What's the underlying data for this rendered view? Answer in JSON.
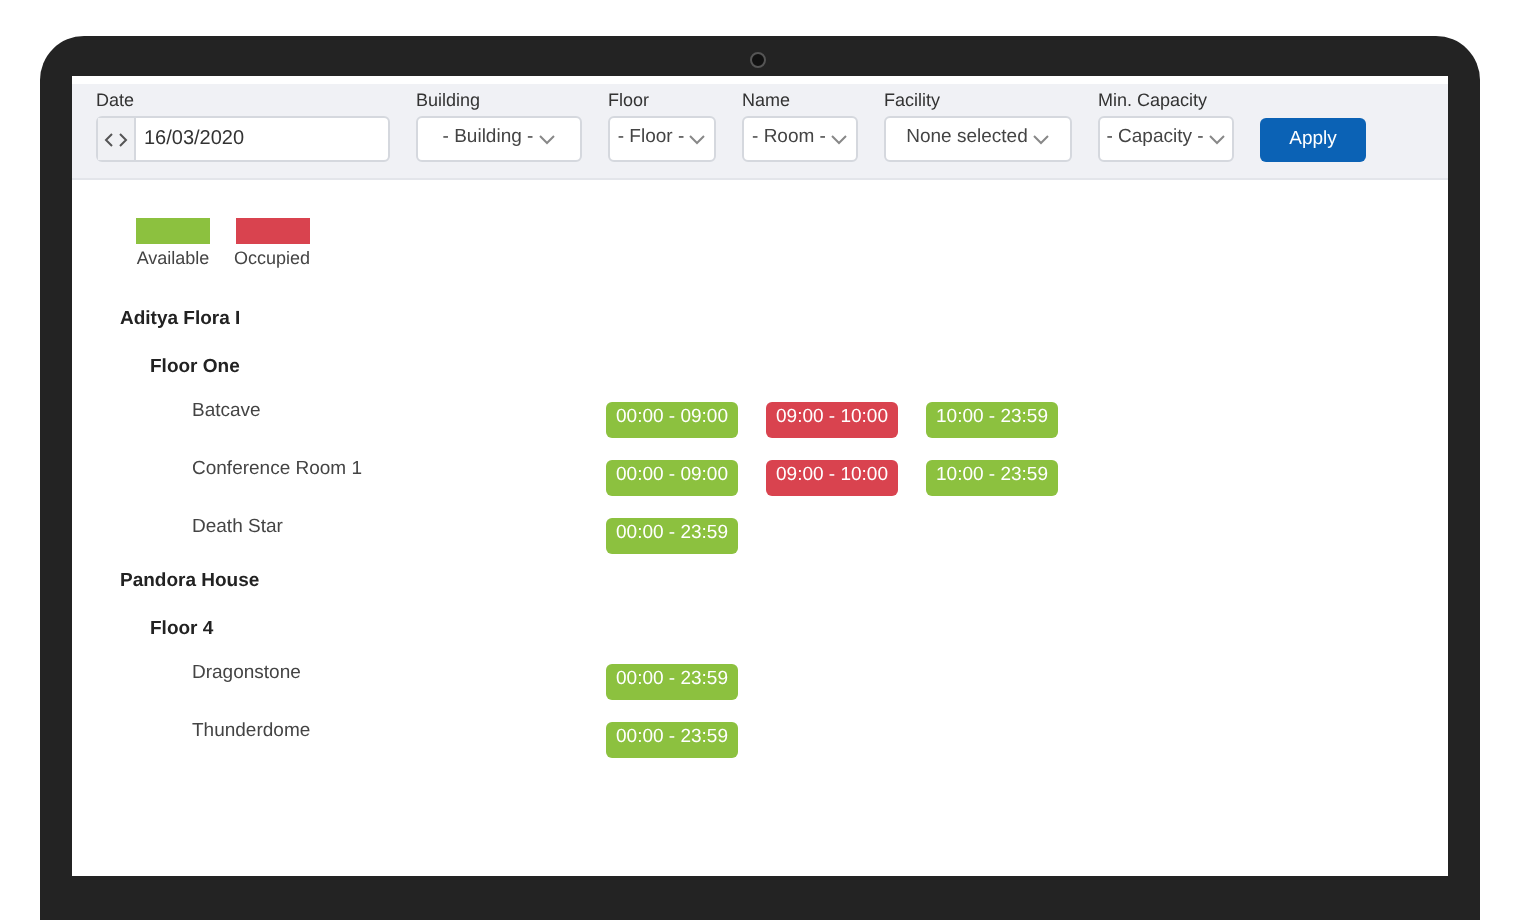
{
  "filters": [
    {
      "label": "Date",
      "kind": "date",
      "value": "16/03/2020"
    },
    {
      "label": "Building",
      "kind": "select",
      "value": "- Building -"
    },
    {
      "label": "Floor",
      "kind": "select",
      "value": "- Floor -"
    },
    {
      "label": "Name",
      "kind": "select",
      "value": "- Room -"
    },
    {
      "label": "Facility",
      "kind": "select",
      "value": "None selected"
    },
    {
      "label": "Min. Capacity",
      "kind": "select",
      "value": "- Capacity -"
    }
  ],
  "apply_button": "Apply",
  "legend": [
    {
      "label": "Available",
      "color": "#8cc13f"
    },
    {
      "label": "Occupied",
      "color": "#d9434f"
    }
  ],
  "buildings": [
    {
      "name": "Aditya Flora I",
      "floors": [
        {
          "name": "Floor One",
          "rooms": [
            {
              "name": "Batcave",
              "slots": [
                {
                  "time": "00:00 - 09:00",
                  "color": "#8cc13f"
                },
                {
                  "time": "09:00 - 10:00",
                  "color": "#d9434f"
                },
                {
                  "time": "10:00 - 23:59",
                  "color": "#8cc13f"
                }
              ]
            },
            {
              "name": "Conference Room 1",
              "slots": [
                {
                  "time": "00:00 - 09:00",
                  "color": "#8cc13f"
                },
                {
                  "time": "09:00 - 10:00",
                  "color": "#d9434f"
                },
                {
                  "time": "10:00 - 23:59",
                  "color": "#8cc13f"
                }
              ]
            },
            {
              "name": "Death Star",
              "slots": [
                {
                  "time": "00:00 - 23:59",
                  "color": "#8cc13f"
                }
              ]
            }
          ]
        }
      ]
    },
    {
      "name": "Pandora House",
      "floors": [
        {
          "name": "Floor 4",
          "rooms": [
            {
              "name": "Dragonstone",
              "slots": [
                {
                  "time": "00:00 - 23:59",
                  "color": "#8cc13f"
                }
              ]
            },
            {
              "name": "Thunderdome",
              "slots": [
                {
                  "time": "00:00 - 23:59",
                  "color": "#8cc13f"
                }
              ]
            }
          ]
        }
      ]
    }
  ]
}
